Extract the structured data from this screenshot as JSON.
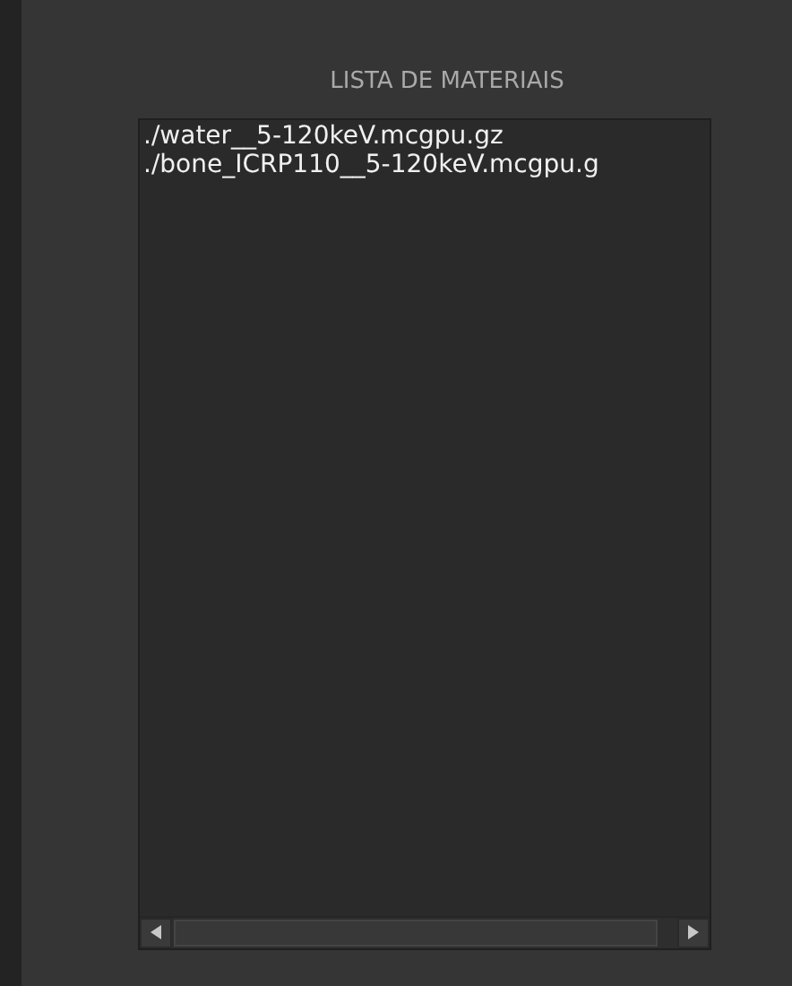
{
  "title": "LISTA DE MATERIAIS",
  "materials": [
    "./water__5-120keV.mcgpu.gz",
    "./bone_ICRP110__5-120keV.mcgpu.g"
  ]
}
